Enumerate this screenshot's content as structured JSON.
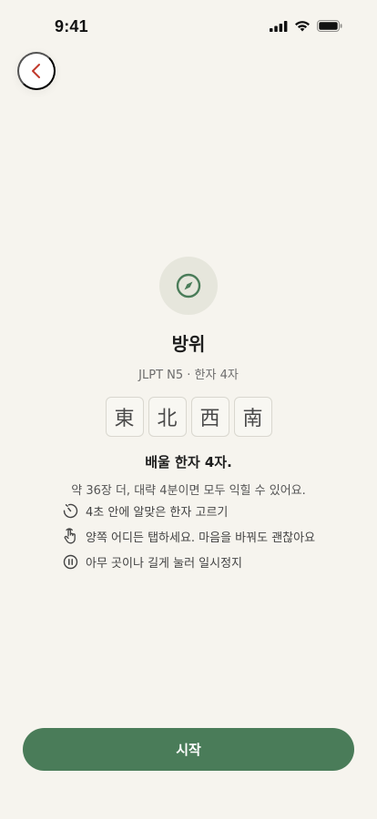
{
  "status_bar": {
    "time": "9:41"
  },
  "icons": {
    "back": "chevron-left-icon",
    "topic": "compass-icon",
    "tips": [
      "timer-icon",
      "tap-hand-icon",
      "pause-icon"
    ]
  },
  "topic": {
    "title": "방위",
    "subtitle": "JLPT N5 · 한자 4자"
  },
  "kanji": [
    "東",
    "北",
    "西",
    "南"
  ],
  "learn": {
    "title": "배울 한자 4자.",
    "description": "약 36장 더, 대략 4분이면 모두 익힐 수 있어요."
  },
  "tips": [
    "4초 안에 알맞은 한자 고르기",
    "양쪽 어디든 탭하세요. 마음을 바꿔도 괜찮아요",
    "아무 곳이나 길게 눌러 일시정지"
  ],
  "start_button": {
    "label": "시작"
  },
  "colors": {
    "background": "#f6f4ee",
    "accent": "#4a7c59",
    "back_chevron": "#c0392b",
    "icon_circle": "#e6e6dc"
  }
}
